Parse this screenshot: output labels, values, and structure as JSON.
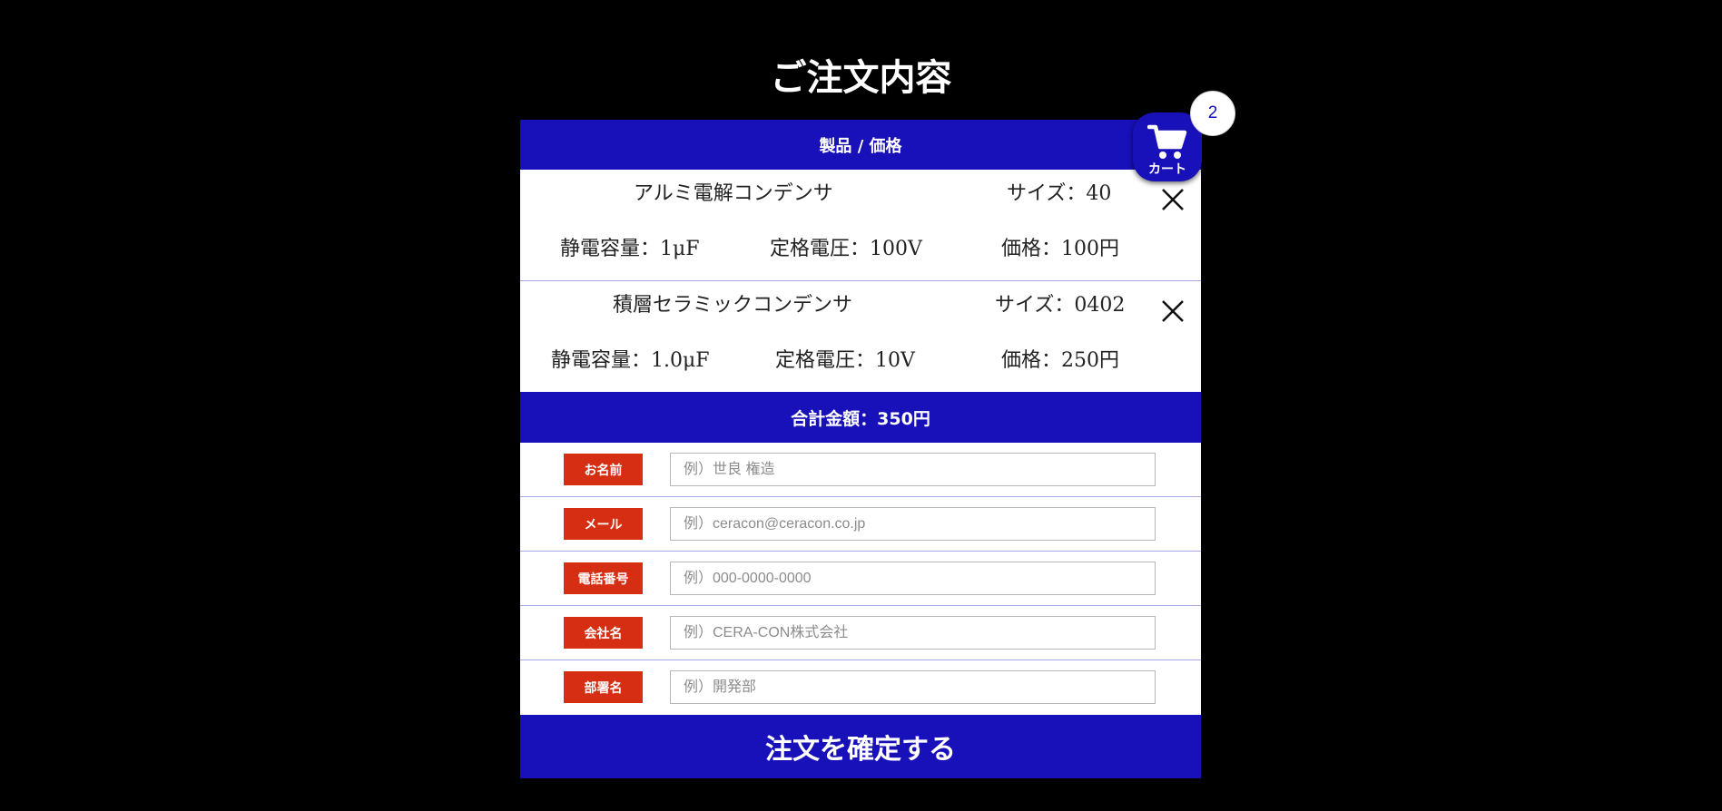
{
  "page_title": "ご注文内容",
  "table": {
    "header": "製品 / 価格",
    "products": [
      {
        "name": "アルミ電解コンデンサ",
        "size": "サイズ：40",
        "capacitance": "静電容量：1μF",
        "voltage": "定格電圧：100V",
        "price": "価格：100円"
      },
      {
        "name": "積層セラミックコンデンサ",
        "size": "サイズ：0402",
        "capacitance": "静電容量：1.0μF",
        "voltage": "定格電圧：10V",
        "price": "価格：250円"
      }
    ],
    "total": "合計金額：350円"
  },
  "form": {
    "fields": [
      {
        "label": "お名前",
        "placeholder": "例）世良 権造"
      },
      {
        "label": "メール",
        "placeholder": "例）ceracon@ceracon.co.jp"
      },
      {
        "label": "電話番号",
        "placeholder": "例）000-0000-0000"
      },
      {
        "label": "会社名",
        "placeholder": "例）CERA-CON株式会社"
      },
      {
        "label": "部署名",
        "placeholder": "例）開発部"
      }
    ],
    "submit_label": "注文を確定する"
  },
  "cart": {
    "label": "カート",
    "count": "2"
  },
  "colors": {
    "brand_blue": "#1810b8",
    "label_red": "#d52e12",
    "background": "#000000",
    "divider": "#a9a8e6"
  },
  "icons": {
    "cart": "cart-icon",
    "remove": "close-icon"
  }
}
